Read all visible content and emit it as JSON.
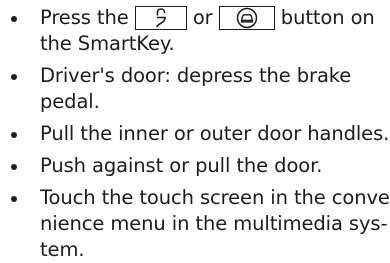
{
  "bullets": [
    {
      "before_lock": "Press the ",
      "lock_icon": "padlock-open-icon",
      "between": " or ",
      "trunk_icon": "car-trunk-icon",
      "after_trunk": " button on",
      "line2": "the SmartKey."
    },
    {
      "line1": "Driver's door: depress the brake",
      "line2": "pedal."
    },
    {
      "line1": "Pull the inner or outer door handles."
    },
    {
      "line1": "Push against or pull the door."
    },
    {
      "line1": "Touch the touch screen in the conve-",
      "line2": "nience menu in the multimedia sys-",
      "line3": "tem."
    }
  ]
}
